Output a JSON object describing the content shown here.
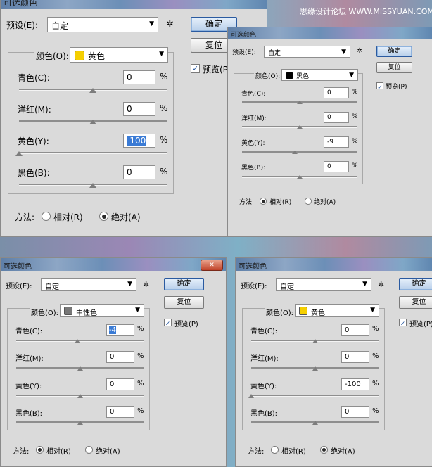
{
  "watermark": "思缘设计论坛 WWW.MISSYUAN.COM",
  "colors": {
    "yellow": "#f5cf00",
    "black": "#000000",
    "neutral": "#777777",
    "accent": "#3a7bd5"
  },
  "dialogs": [
    {
      "title": "可选颜色",
      "preset_label": "预设(E):",
      "preset_value": "自定",
      "ok_label": "确定",
      "reset_label": "复位",
      "preview_label": "预览(P)",
      "preview_checked": true,
      "colors_label": "颜色(O):",
      "color_value": "黄色",
      "swatch": "yellow",
      "sliders": [
        {
          "label": "青色(C):",
          "value": "0",
          "unit": "%",
          "highlight": false,
          "level": 0
        },
        {
          "label": "洋红(M):",
          "value": "0",
          "unit": "%",
          "highlight": false,
          "level": 0
        },
        {
          "label": "黄色(Y):",
          "value": "-100",
          "unit": "%",
          "highlight": true,
          "level": -100
        },
        {
          "label": "黑色(B):",
          "value": "0",
          "unit": "%",
          "highlight": false,
          "level": 0
        }
      ],
      "method_label": "方法:",
      "relative_label": "相对(R)",
      "absolute_label": "绝对(A)",
      "method_selected": "absolute"
    },
    {
      "title": "可选颜色",
      "preset_label": "预设(E):",
      "preset_value": "自定",
      "ok_label": "确定",
      "reset_label": "复位",
      "preview_label": "预览(P)",
      "preview_checked": true,
      "colors_label": "颜色(O):",
      "color_value": "黑色",
      "swatch": "black",
      "sliders": [
        {
          "label": "青色(C):",
          "value": "0",
          "unit": "%",
          "highlight": false,
          "level": 0
        },
        {
          "label": "洋红(M):",
          "value": "0",
          "unit": "%",
          "highlight": false,
          "level": 0
        },
        {
          "label": "黄色(Y):",
          "value": "-9",
          "unit": "%",
          "highlight": false,
          "level": -9
        },
        {
          "label": "黑色(B):",
          "value": "0",
          "unit": "%",
          "highlight": false,
          "level": 0
        }
      ],
      "method_label": "方法:",
      "relative_label": "相对(R)",
      "absolute_label": "绝对(A)",
      "method_selected": "relative"
    },
    {
      "title": "可选颜色",
      "preset_label": "预设(E):",
      "preset_value": "自定",
      "ok_label": "确定",
      "reset_label": "复位",
      "preview_label": "预览(P)",
      "preview_checked": true,
      "colors_label": "颜色(O):",
      "color_value": "中性色",
      "swatch": "neutral",
      "sliders": [
        {
          "label": "青色(C):",
          "value": "-4",
          "unit": "%",
          "highlight": true,
          "level": -4
        },
        {
          "label": "洋红(M):",
          "value": "0",
          "unit": "%",
          "highlight": false,
          "level": 0
        },
        {
          "label": "黄色(Y):",
          "value": "0",
          "unit": "%",
          "highlight": false,
          "level": 0
        },
        {
          "label": "黑色(B):",
          "value": "0",
          "unit": "%",
          "highlight": false,
          "level": 0
        }
      ],
      "method_label": "方法:",
      "relative_label": "相对(R)",
      "absolute_label": "绝对(A)",
      "method_selected": "relative"
    },
    {
      "title": "可选颜色",
      "preset_label": "预设(E):",
      "preset_value": "自定",
      "ok_label": "确定",
      "reset_label": "复位",
      "preview_label": "预览(P)",
      "preview_checked": true,
      "colors_label": "颜色(O):",
      "color_value": "黄色",
      "swatch": "yellow",
      "sliders": [
        {
          "label": "青色(C):",
          "value": "0",
          "unit": "%",
          "highlight": false,
          "level": 0
        },
        {
          "label": "洋红(M):",
          "value": "0",
          "unit": "%",
          "highlight": false,
          "level": 0
        },
        {
          "label": "黄色(Y):",
          "value": "-100",
          "unit": "%",
          "highlight": false,
          "level": -100
        },
        {
          "label": "黑色(B):",
          "value": "0",
          "unit": "%",
          "highlight": false,
          "level": 0
        }
      ],
      "method_label": "方法:",
      "relative_label": "相对(R)",
      "absolute_label": "绝对(A)",
      "method_selected": "absolute"
    }
  ]
}
